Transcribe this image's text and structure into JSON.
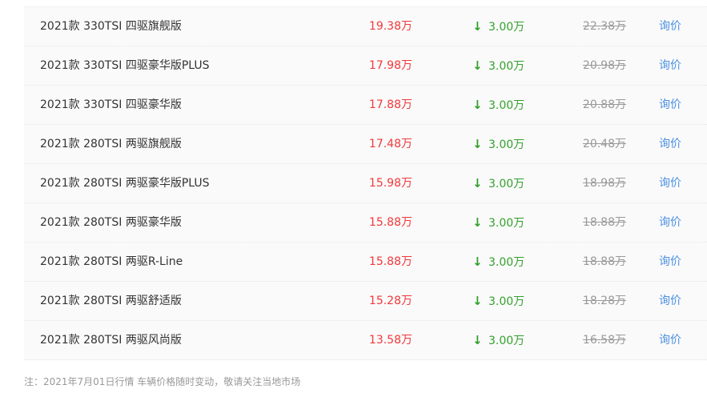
{
  "rows": [
    {
      "name": "2021款 330TSI 四驱旗舰版",
      "price": "19.38万",
      "drop": "3.00万",
      "original": "22.38万",
      "action": "询价"
    },
    {
      "name": "2021款 330TSI 四驱豪华版PLUS",
      "price": "17.98万",
      "drop": "3.00万",
      "original": "20.98万",
      "action": "询价"
    },
    {
      "name": "2021款 330TSI 四驱豪华版",
      "price": "17.88万",
      "drop": "3.00万",
      "original": "20.88万",
      "action": "询价"
    },
    {
      "name": "2021款 280TSI 两驱旗舰版",
      "price": "17.48万",
      "drop": "3.00万",
      "original": "20.48万",
      "action": "询价"
    },
    {
      "name": "2021款 280TSI 两驱豪华版PLUS",
      "price": "15.98万",
      "drop": "3.00万",
      "original": "18.98万",
      "action": "询价"
    },
    {
      "name": "2021款 280TSI 两驱豪华版",
      "price": "15.88万",
      "drop": "3.00万",
      "original": "18.88万",
      "action": "询价"
    },
    {
      "name": "2021款 280TSI 两驱R-Line",
      "price": "15.88万",
      "drop": "3.00万",
      "original": "18.88万",
      "action": "询价"
    },
    {
      "name": "2021款 280TSI 两驱舒适版",
      "price": "15.28万",
      "drop": "3.00万",
      "original": "18.28万",
      "action": "询价"
    },
    {
      "name": "2021款 280TSI 两驱风尚版",
      "price": "13.58万",
      "drop": "3.00万",
      "original": "16.58万",
      "action": "询价"
    }
  ],
  "icons": {
    "drop_arrow": "down-arrow-icon"
  },
  "colors": {
    "price": "#f2383a",
    "drop": "#33a02c",
    "original": "#999999",
    "link": "#4a90e2"
  },
  "footnote": "注：2021年7月01日行情 车辆价格随时变动，敬请关注当地市场"
}
